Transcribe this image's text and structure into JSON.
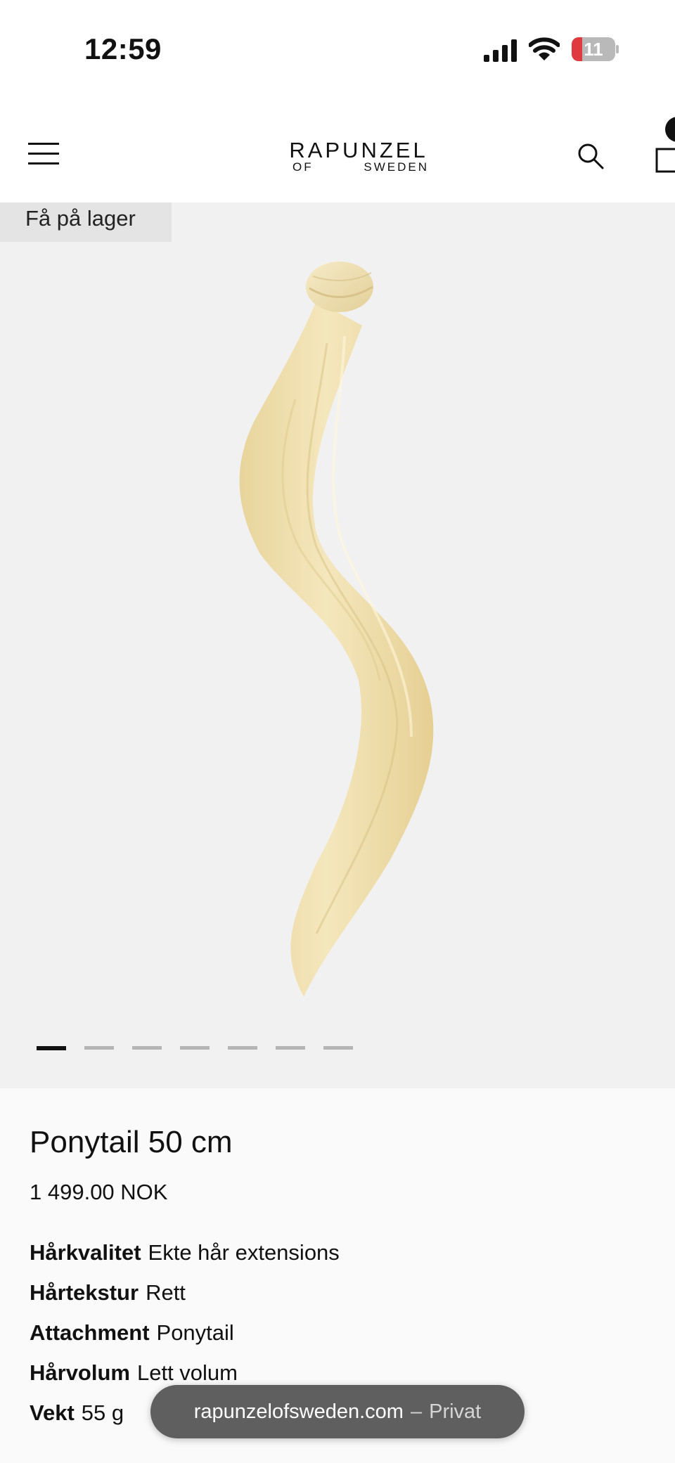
{
  "status_bar": {
    "time": "12:59",
    "battery_level": "11",
    "icons": [
      "signal-icon",
      "wifi-icon",
      "battery-icon"
    ]
  },
  "header": {
    "logo_top": "RAPUNZEL",
    "logo_bottom_left": "OF",
    "logo_bottom_right": "SWEDEN",
    "icons": [
      "menu-icon",
      "search-icon",
      "cart-icon"
    ]
  },
  "gallery": {
    "stock_badge": "Få på lager",
    "slide_count": 7,
    "active_slide": 1,
    "image": "blonde-ponytail-extension"
  },
  "product": {
    "title": "Ponytail 50 cm",
    "price": "1 499.00 NOK",
    "attributes": [
      {
        "key": "Hårkvalitet",
        "value": "Ekte hår extensions"
      },
      {
        "key": "Hårtekstur",
        "value": "Rett"
      },
      {
        "key": "Attachment",
        "value": "Ponytail"
      },
      {
        "key": "Hårvolum",
        "value": "Lett volum"
      },
      {
        "key": "Vekt",
        "value": "55 g"
      }
    ]
  },
  "browser": {
    "domain": "rapunzelofsweden.com",
    "separator": "–",
    "mode": "Privat"
  },
  "colors": {
    "gallery_bg": "#f1f1f1",
    "hair": "#f0dfae",
    "accent": "#111111"
  }
}
